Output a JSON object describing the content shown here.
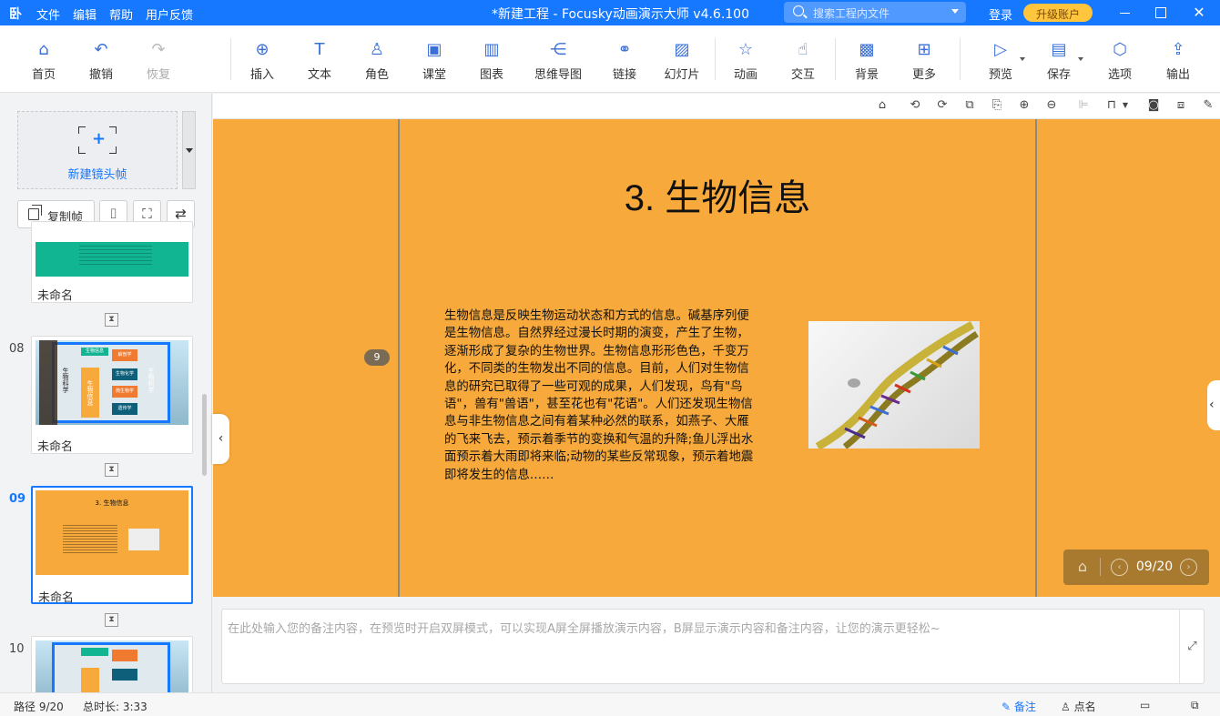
{
  "app": {
    "logo_glyph": "卧",
    "title": "*新建工程 - Focusky动画演示大师  v4.6.100",
    "menu": [
      "文件",
      "编辑",
      "帮助",
      "用户反馈"
    ],
    "search_placeholder": "搜索工程内文件",
    "login": "登录",
    "upgrade": "升级账户",
    "accent_color": "#1677ff",
    "upgrade_color": "#ffc53d"
  },
  "toolbar": {
    "home": "首页",
    "undo": "撤销",
    "redo": "恢复",
    "insert": "插入",
    "text": "文本",
    "role": "角色",
    "classroom": "课堂",
    "chart": "图表",
    "mindmap": "思维导图",
    "link": "链接",
    "slide": "幻灯片",
    "animation": "动画",
    "interaction": "交互",
    "background": "背景",
    "more": "更多",
    "preview": "预览",
    "save": "保存",
    "options": "选项",
    "export": "输出"
  },
  "left_panel": {
    "new_frame": "新建镜头帧",
    "copy_frame": "复制帧",
    "frames": [
      {
        "number": "",
        "name": "未命名",
        "selected": false
      },
      {
        "number": "08",
        "name": "未命名",
        "selected": false
      },
      {
        "number": "09",
        "name": "未命名",
        "selected": true,
        "thumb_title": "3. 生物信息"
      },
      {
        "number": "10",
        "name": "",
        "selected": false
      }
    ],
    "mini_labels": {
      "bio_left": "生物科学",
      "bio_right": "生物科学",
      "center": "生物信息",
      "top": "生物信息",
      "l1": "解剖学",
      "l2": "生物化学",
      "l3": "微生物学",
      "l4": "遗传学"
    }
  },
  "slide": {
    "title": "3. 生物信息",
    "body": "生物信息是反映生物运动状态和方式的信息。碱基序列便是生物信息。自然界经过漫长时期的演变，产生了生物，逐渐形成了复杂的生物世界。生物信息形形色色，千变万化，不同类的生物发出不同的信息。目前，人们对生物信息的研究已取得了一些可观的成果，人们发现，鸟有\"鸟语\"，兽有\"兽语\"，甚至花也有\"花语\"。人们还发现生物信息与非生物信息之间有着某种必然的联系，如燕子、大雁的飞来飞去，预示着季节的变换和气温的升降;鱼儿浮出水面预示着大雨即将来临;动物的某些反常现象，预示着地震即将发生的信息……",
    "step_badge": "9",
    "background_color": "#f7a93b",
    "image_desc_icon": "dna-helix-image"
  },
  "nav": {
    "counter": "09/20"
  },
  "notes": {
    "placeholder": "在此处输入您的备注内容，在预览时开启双屏模式，可以实现A屏全屏播放演示内容，B屏显示演示内容和备注内容，让您的演示更轻松~"
  },
  "status": {
    "path": "路径 9/20",
    "duration": "总时长: 3:33",
    "notes": "备注",
    "rollcall": "点名"
  }
}
